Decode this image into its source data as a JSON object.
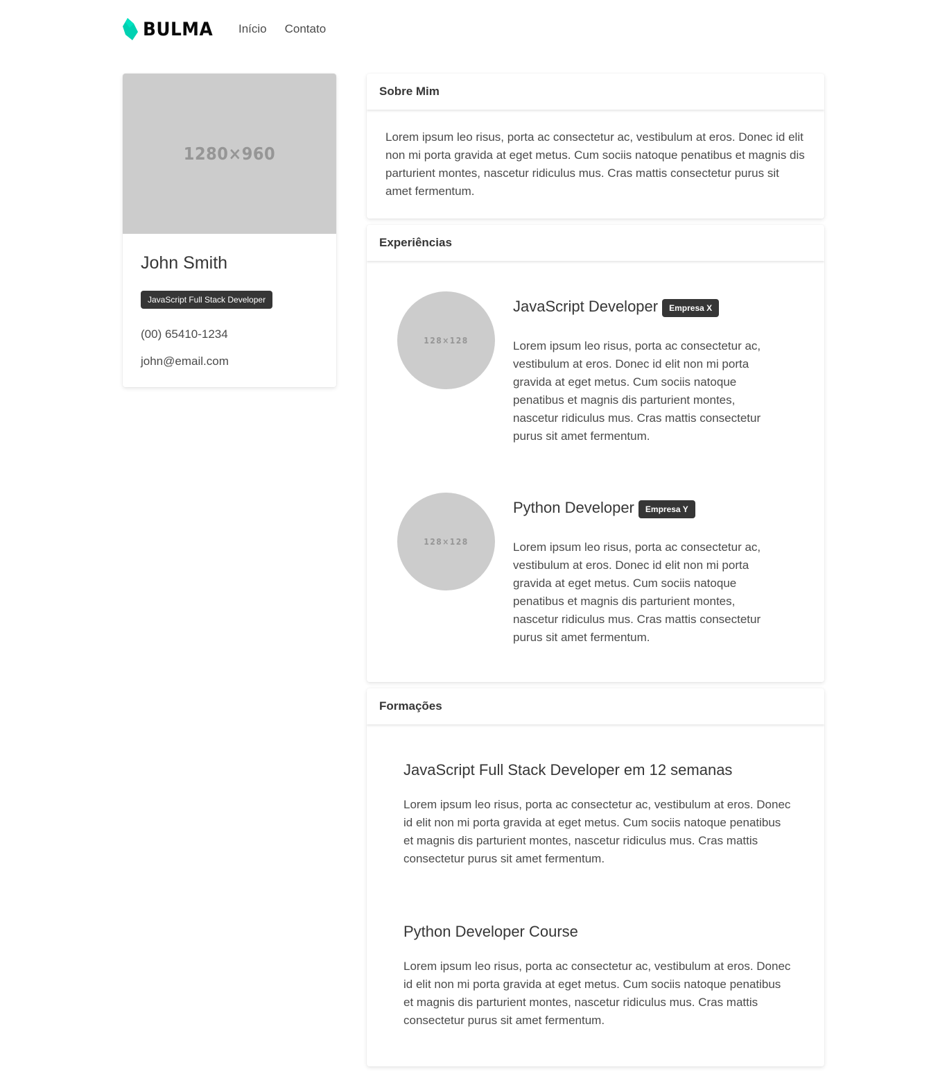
{
  "navbar": {
    "brand": "BULMA",
    "brand_color": "#00d1b2",
    "items": [
      {
        "label": "Início"
      },
      {
        "label": "Contato"
      }
    ]
  },
  "profile": {
    "image_placeholder": "1280×960",
    "name": "John Smith",
    "role_tag": "JavaScript Full Stack Developer",
    "phone": "(00) 65410-1234",
    "email": "john@email.com"
  },
  "about": {
    "title": "Sobre Mim",
    "text": "Lorem ipsum leo risus, porta ac consectetur ac, vestibulum at eros. Donec id elit non mi porta gravida at eget metus. Cum sociis natoque penatibus et magnis dis parturient montes, nascetur ridiculus mus. Cras mattis consectetur purus sit amet fermentum."
  },
  "experience": {
    "title": "Experiências",
    "items": [
      {
        "avatar_placeholder": "128×128",
        "role": "JavaScript Developer",
        "company": "Empresa X",
        "text": "Lorem ipsum leo risus, porta ac consectetur ac, vestibulum at eros. Donec id elit non mi porta gravida at eget metus. Cum sociis natoque penatibus et magnis dis parturient montes, nascetur ridiculus mus. Cras mattis consectetur purus sit amet fermentum."
      },
      {
        "avatar_placeholder": "128×128",
        "role": "Python Developer",
        "company": "Empresa Y",
        "text": "Lorem ipsum leo risus, porta ac consectetur ac, vestibulum at eros. Donec id elit non mi porta gravida at eget metus. Cum sociis natoque penatibus et magnis dis parturient montes, nascetur ridiculus mus. Cras mattis consectetur purus sit amet fermentum."
      }
    ]
  },
  "education": {
    "title": "Formações",
    "items": [
      {
        "title": "JavaScript Full Stack Developer em 12 semanas",
        "text": "Lorem ipsum leo risus, porta ac consectetur ac, vestibulum at eros. Donec id elit non mi porta gravida at eget metus. Cum sociis natoque penatibus et magnis dis parturient montes, nascetur ridiculus mus. Cras mattis consectetur purus sit amet fermentum."
      },
      {
        "title": "Python Developer Course",
        "text": "Lorem ipsum leo risus, porta ac consectetur ac, vestibulum at eros. Donec id elit non mi porta gravida at eget metus. Cum sociis natoque penatibus et magnis dis parturient montes, nascetur ridiculus mus. Cras mattis consectetur purus sit amet fermentum."
      }
    ]
  }
}
